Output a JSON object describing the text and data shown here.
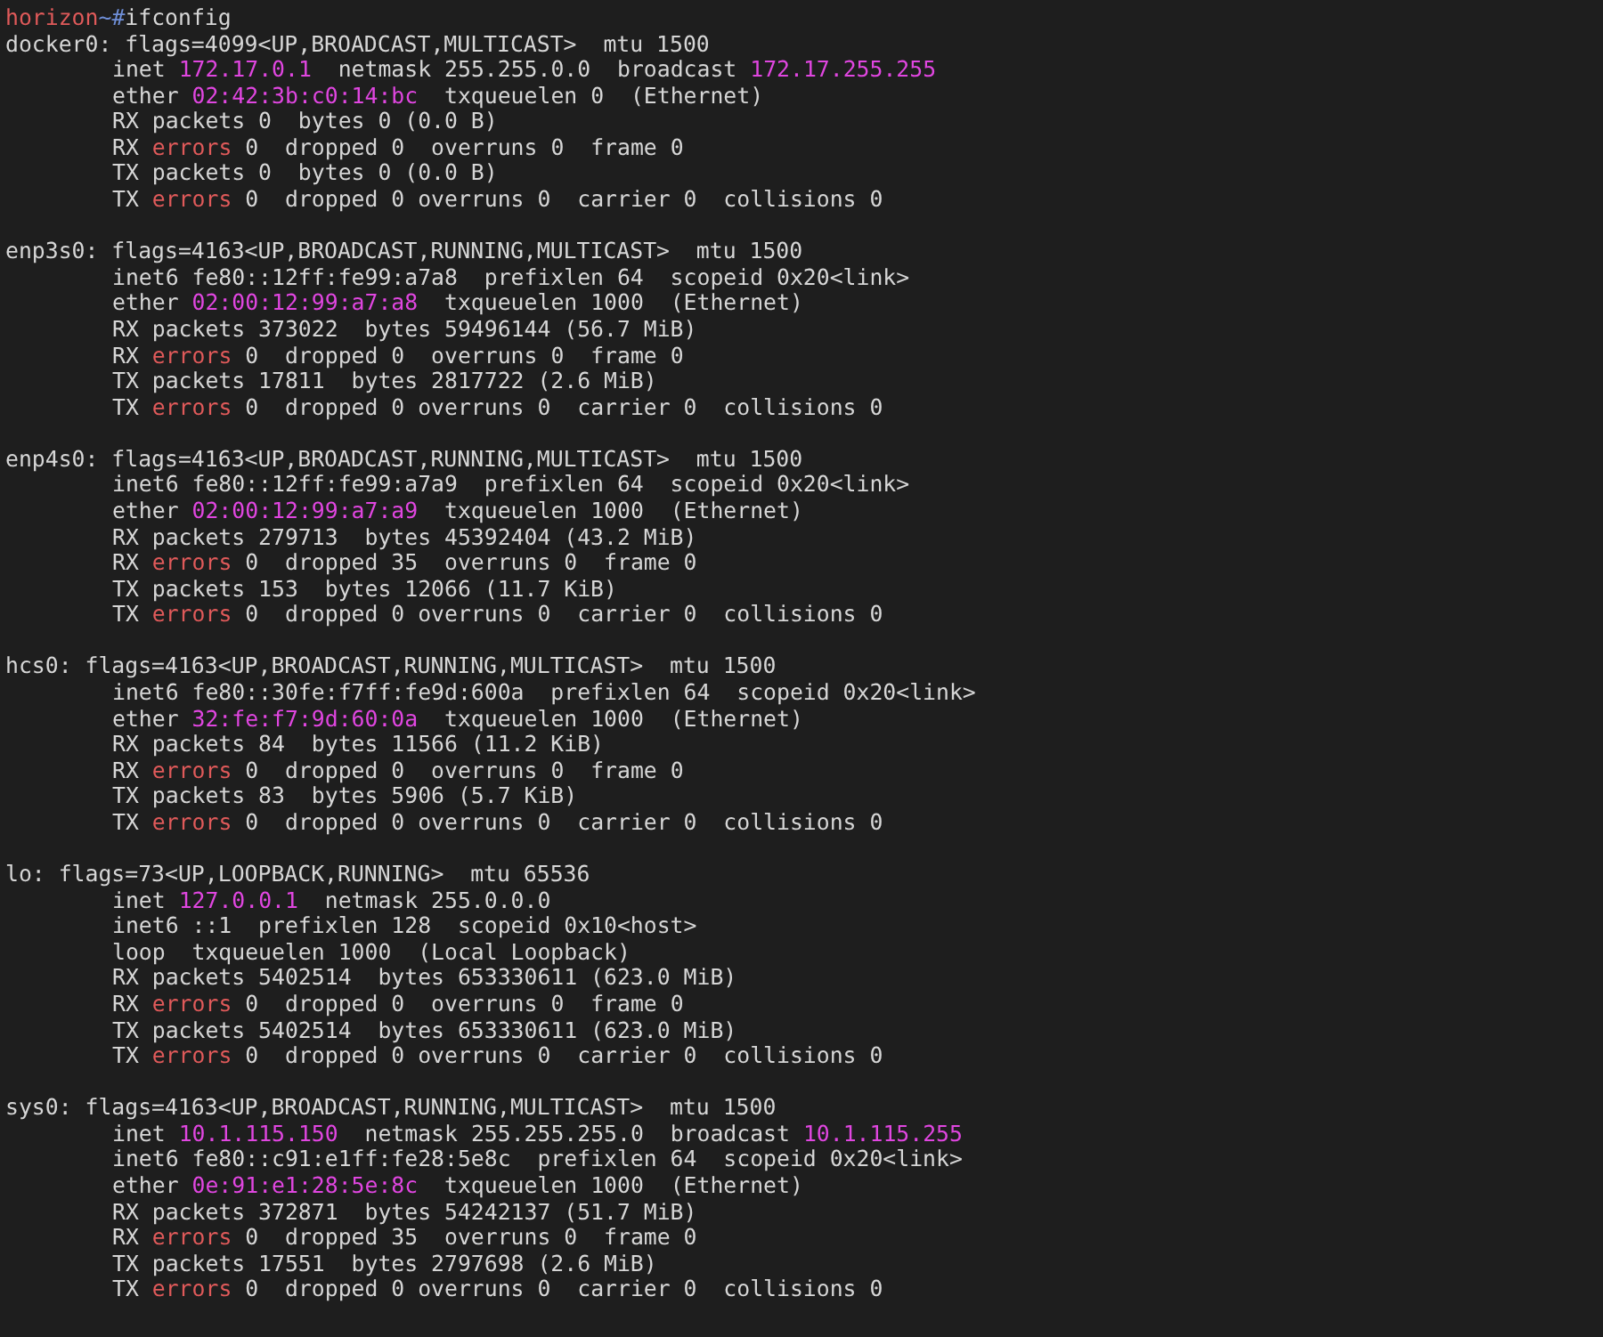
{
  "prompt": {
    "user": "horizon",
    "path": "~",
    "symbol": "#",
    "command": "ifconfig"
  },
  "interfaces": [
    {
      "header": "docker0: flags=4099<UP,BROADCAST,MULTICAST>  mtu 1500",
      "lines": [
        [
          {
            "text": "inet ",
            "kind": "plain"
          },
          {
            "text": "172.17.0.1",
            "kind": "addr"
          },
          {
            "text": "  netmask 255.255.0.0  broadcast ",
            "kind": "plain"
          },
          {
            "text": "172.17.255.255",
            "kind": "addr"
          }
        ],
        [
          {
            "text": "ether ",
            "kind": "plain"
          },
          {
            "text": "02:42:3b:c0:14:bc",
            "kind": "addr"
          },
          {
            "text": "  txqueuelen 0  (Ethernet)",
            "kind": "plain"
          }
        ],
        [
          {
            "text": "RX packets 0  bytes 0 (0.0 B)",
            "kind": "plain"
          }
        ],
        [
          {
            "text": "RX ",
            "kind": "plain"
          },
          {
            "text": "errors",
            "kind": "error"
          },
          {
            "text": " 0  dropped 0  overruns 0  frame 0",
            "kind": "plain"
          }
        ],
        [
          {
            "text": "TX packets 0  bytes 0 (0.0 B)",
            "kind": "plain"
          }
        ],
        [
          {
            "text": "TX ",
            "kind": "plain"
          },
          {
            "text": "errors",
            "kind": "error"
          },
          {
            "text": " 0  dropped 0 overruns 0  carrier 0  collisions 0",
            "kind": "plain"
          }
        ]
      ]
    },
    {
      "header": "enp3s0: flags=4163<UP,BROADCAST,RUNNING,MULTICAST>  mtu 1500",
      "lines": [
        [
          {
            "text": "inet6 fe80::12ff:fe99:a7a8  prefixlen 64  scopeid 0x20<link>",
            "kind": "plain"
          }
        ],
        [
          {
            "text": "ether ",
            "kind": "plain"
          },
          {
            "text": "02:00:12:99:a7:a8",
            "kind": "addr"
          },
          {
            "text": "  txqueuelen 1000  (Ethernet)",
            "kind": "plain"
          }
        ],
        [
          {
            "text": "RX packets 373022  bytes 59496144 (56.7 MiB)",
            "kind": "plain"
          }
        ],
        [
          {
            "text": "RX ",
            "kind": "plain"
          },
          {
            "text": "errors",
            "kind": "error"
          },
          {
            "text": " 0  dropped 0  overruns 0  frame 0",
            "kind": "plain"
          }
        ],
        [
          {
            "text": "TX packets 17811  bytes 2817722 (2.6 MiB)",
            "kind": "plain"
          }
        ],
        [
          {
            "text": "TX ",
            "kind": "plain"
          },
          {
            "text": "errors",
            "kind": "error"
          },
          {
            "text": " 0  dropped 0 overruns 0  carrier 0  collisions 0",
            "kind": "plain"
          }
        ]
      ]
    },
    {
      "header": "enp4s0: flags=4163<UP,BROADCAST,RUNNING,MULTICAST>  mtu 1500",
      "lines": [
        [
          {
            "text": "inet6 fe80::12ff:fe99:a7a9  prefixlen 64  scopeid 0x20<link>",
            "kind": "plain"
          }
        ],
        [
          {
            "text": "ether ",
            "kind": "plain"
          },
          {
            "text": "02:00:12:99:a7:a9",
            "kind": "addr"
          },
          {
            "text": "  txqueuelen 1000  (Ethernet)",
            "kind": "plain"
          }
        ],
        [
          {
            "text": "RX packets 279713  bytes 45392404 (43.2 MiB)",
            "kind": "plain"
          }
        ],
        [
          {
            "text": "RX ",
            "kind": "plain"
          },
          {
            "text": "errors",
            "kind": "error"
          },
          {
            "text": " 0  dropped 35  overruns 0  frame 0",
            "kind": "plain"
          }
        ],
        [
          {
            "text": "TX packets 153  bytes 12066 (11.7 KiB)",
            "kind": "plain"
          }
        ],
        [
          {
            "text": "TX ",
            "kind": "plain"
          },
          {
            "text": "errors",
            "kind": "error"
          },
          {
            "text": " 0  dropped 0 overruns 0  carrier 0  collisions 0",
            "kind": "plain"
          }
        ]
      ]
    },
    {
      "header": "hcs0: flags=4163<UP,BROADCAST,RUNNING,MULTICAST>  mtu 1500",
      "lines": [
        [
          {
            "text": "inet6 fe80::30fe:f7ff:fe9d:600a  prefixlen 64  scopeid 0x20<link>",
            "kind": "plain"
          }
        ],
        [
          {
            "text": "ether ",
            "kind": "plain"
          },
          {
            "text": "32:fe:f7:9d:60:0a",
            "kind": "addr"
          },
          {
            "text": "  txqueuelen 1000  (Ethernet)",
            "kind": "plain"
          }
        ],
        [
          {
            "text": "RX packets 84  bytes 11566 (11.2 KiB)",
            "kind": "plain"
          }
        ],
        [
          {
            "text": "RX ",
            "kind": "plain"
          },
          {
            "text": "errors",
            "kind": "error"
          },
          {
            "text": " 0  dropped 0  overruns 0  frame 0",
            "kind": "plain"
          }
        ],
        [
          {
            "text": "TX packets 83  bytes 5906 (5.7 KiB)",
            "kind": "plain"
          }
        ],
        [
          {
            "text": "TX ",
            "kind": "plain"
          },
          {
            "text": "errors",
            "kind": "error"
          },
          {
            "text": " 0  dropped 0 overruns 0  carrier 0  collisions 0",
            "kind": "plain"
          }
        ]
      ]
    },
    {
      "header": "lo: flags=73<UP,LOOPBACK,RUNNING>  mtu 65536",
      "lines": [
        [
          {
            "text": "inet ",
            "kind": "plain"
          },
          {
            "text": "127.0.0.1",
            "kind": "addr"
          },
          {
            "text": "  netmask 255.0.0.0",
            "kind": "plain"
          }
        ],
        [
          {
            "text": "inet6 ::1  prefixlen 128  scopeid 0x10<host>",
            "kind": "plain"
          }
        ],
        [
          {
            "text": "loop  txqueuelen 1000  (Local Loopback)",
            "kind": "plain"
          }
        ],
        [
          {
            "text": "RX packets 5402514  bytes 653330611 (623.0 MiB)",
            "kind": "plain"
          }
        ],
        [
          {
            "text": "RX ",
            "kind": "plain"
          },
          {
            "text": "errors",
            "kind": "error"
          },
          {
            "text": " 0  dropped 0  overruns 0  frame 0",
            "kind": "plain"
          }
        ],
        [
          {
            "text": "TX packets 5402514  bytes 653330611 (623.0 MiB)",
            "kind": "plain"
          }
        ],
        [
          {
            "text": "TX ",
            "kind": "plain"
          },
          {
            "text": "errors",
            "kind": "error"
          },
          {
            "text": " 0  dropped 0 overruns 0  carrier 0  collisions 0",
            "kind": "plain"
          }
        ]
      ]
    },
    {
      "header": "sys0: flags=4163<UP,BROADCAST,RUNNING,MULTICAST>  mtu 1500",
      "lines": [
        [
          {
            "text": "inet ",
            "kind": "plain"
          },
          {
            "text": "10.1.115.150",
            "kind": "addr"
          },
          {
            "text": "  netmask 255.255.255.0  broadcast ",
            "kind": "plain"
          },
          {
            "text": "10.1.115.255",
            "kind": "addr"
          }
        ],
        [
          {
            "text": "inet6 fe80::c91:e1ff:fe28:5e8c  prefixlen 64  scopeid 0x20<link>",
            "kind": "plain"
          }
        ],
        [
          {
            "text": "ether ",
            "kind": "plain"
          },
          {
            "text": "0e:91:e1:28:5e:8c",
            "kind": "addr"
          },
          {
            "text": "  txqueuelen 1000  (Ethernet)",
            "kind": "plain"
          }
        ],
        [
          {
            "text": "RX packets 372871  bytes 54242137 (51.7 MiB)",
            "kind": "plain"
          }
        ],
        [
          {
            "text": "RX ",
            "kind": "plain"
          },
          {
            "text": "errors",
            "kind": "error"
          },
          {
            "text": " 0  dropped 35  overruns 0  frame 0",
            "kind": "plain"
          }
        ],
        [
          {
            "text": "TX packets 17551  bytes 2797698 (2.6 MiB)",
            "kind": "plain"
          }
        ],
        [
          {
            "text": "TX ",
            "kind": "plain"
          },
          {
            "text": "errors",
            "kind": "error"
          },
          {
            "text": " 0  dropped 0 overruns 0  carrier 0  collisions 0",
            "kind": "plain"
          }
        ]
      ]
    }
  ]
}
